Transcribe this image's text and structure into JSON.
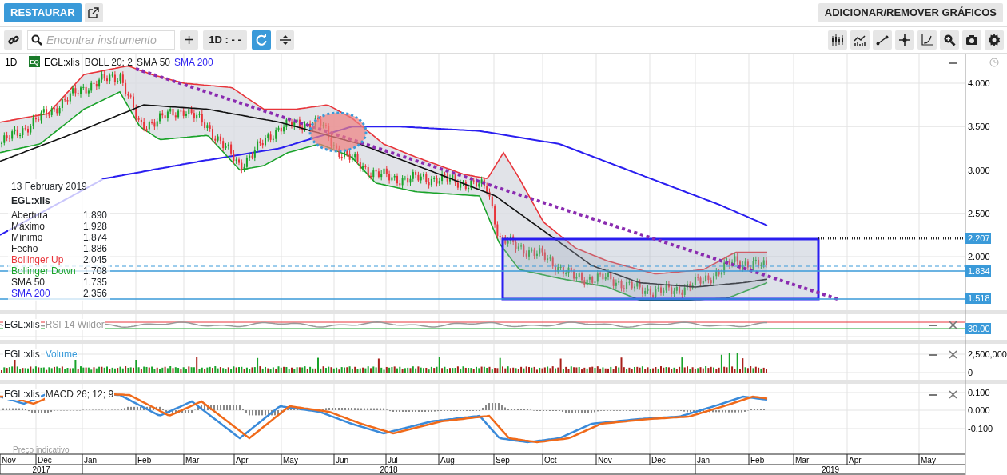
{
  "header": {
    "restore_button": "RESTAURAR",
    "add_remove_button": "ADICIONAR/REMOVER GRÁFICOS"
  },
  "toolbar": {
    "search": {
      "placeholder": "Encontrar instrumento"
    },
    "add_button": "+",
    "interval_button": "1D : - -"
  },
  "main_chart": {
    "interval": "1D",
    "exchange_badge": "EQ",
    "symbol": "EGL:xlis",
    "indicators": [
      {
        "label": "BOLL 20; 2",
        "color": "#222222"
      },
      {
        "label": "SMA 50",
        "color": "#222222"
      },
      {
        "label": "SMA 200",
        "color": "#2a1ef0"
      }
    ],
    "y_ticks": [
      "4.000",
      "3.500",
      "3.000",
      "2.500",
      "2.000"
    ],
    "price_tags": [
      "2.207",
      "1.834",
      "1.518"
    ]
  },
  "tooltip": {
    "date": "13 February 2019",
    "symbol": "EGL:xlis",
    "rows": [
      {
        "label": "Abertura",
        "value": "1.890",
        "color": "#222222"
      },
      {
        "label": "Máximo",
        "value": "1.928",
        "color": "#222222"
      },
      {
        "label": "Mínimo",
        "value": "1.874",
        "color": "#222222"
      },
      {
        "label": "Fecho",
        "value": "1.886",
        "color": "#222222"
      },
      {
        "label": "Bollinger Up",
        "value": "2.045",
        "color": "#e8343a"
      },
      {
        "label": "Bollinger Down",
        "value": "1.708",
        "color": "#1aa32a"
      },
      {
        "label": "SMA 50",
        "value": "1.735",
        "color": "#222222"
      },
      {
        "label": "SMA 200",
        "value": "2.356",
        "color": "#2a1ef0"
      }
    ]
  },
  "panels": [
    {
      "kind": "rsi",
      "symbol": "EGL:xlis",
      "indicator": "RSI 14 Wilder",
      "color": "#999999",
      "y_labels": [
        "30.00"
      ]
    },
    {
      "kind": "volume",
      "symbol": "EGL:xlis",
      "indicator": "Volume",
      "color": "#3a9ad9",
      "y_labels": [
        "2,500,000",
        "0"
      ]
    },
    {
      "kind": "macd",
      "symbol": "EGL:xlis",
      "indicator": "MACD 26; 12; 9",
      "color": "#222222",
      "y_labels": [
        "0.100",
        "0.000",
        "-0.100"
      ]
    }
  ],
  "footnote": "Preço indicativo",
  "x_axis": {
    "months": [
      "Nov",
      "Dec",
      "Jan",
      "Feb",
      "Mar",
      "Apr",
      "May",
      "Jun",
      "Jul",
      "Aug",
      "Sep",
      "Oct",
      "Nov",
      "Dec",
      "Jan",
      "Feb",
      "Mar",
      "Apr",
      "May"
    ],
    "years": [
      "2017",
      "2018",
      "2019"
    ]
  }
}
